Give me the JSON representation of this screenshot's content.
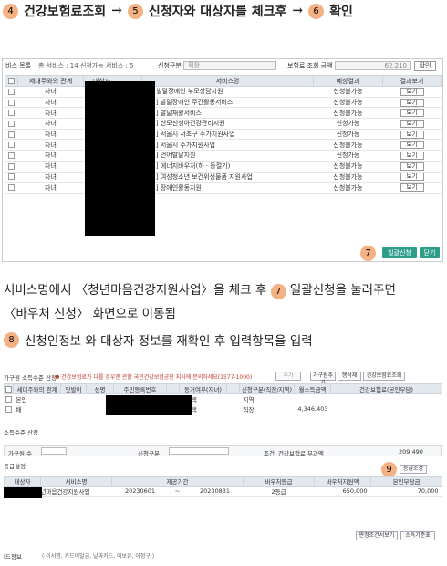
{
  "step_header": {
    "step4_num": "4",
    "step4_text": "건강보험료조회",
    "arrow": "→",
    "step5_num": "5",
    "step5_text": "신청자와 대상자를 체크후",
    "step6_num": "6",
    "step6_text": "확인"
  },
  "screen1": {
    "list_title": "비스 목록",
    "count_text": "총 서비스 : 14 신청가능 서비스 : 5",
    "category_label": "신청구분",
    "category_value": "직장",
    "insurance_label": "보험료 조회 금액",
    "insurance_value": "62,210",
    "confirm_label": "확인",
    "columns": [
      "",
      "세대주와의 관계",
      "대상자",
      "",
      "서비스명",
      "예상결과",
      "결과보기"
    ],
    "rows": [
      {
        "relation": "자녀",
        "service": "03] 발달장애인 부모상담지원",
        "result": "신청불가능",
        "view": "보기"
      },
      {
        "relation": "자녀",
        "service": "001] 발달장애인 주간활동서비스",
        "result": "신청불가능",
        "view": "보기"
      },
      {
        "relation": "자녀",
        "service": "001] 발달재활서비스",
        "result": "신청불가능",
        "view": "보기"
      },
      {
        "relation": "자녀",
        "service": "001] 산모신생아건강관리지원",
        "result": "신청가능",
        "view": "보기"
      },
      {
        "relation": "자녀",
        "service": "022] 서울시 서초구 주가지원사업",
        "result": "신청가능",
        "view": "보기"
      },
      {
        "relation": "자녀",
        "service": "001] 서울시 주가지원사업",
        "result": "신청불가능",
        "view": "보기"
      },
      {
        "relation": "자녀",
        "service": "002] 언어발달지원",
        "result": "신청가능",
        "view": "보기"
      },
      {
        "relation": "자녀",
        "service": "001] 에너지바우처(하 · 동절기)",
        "result": "신청불가능",
        "view": "보기"
      },
      {
        "relation": "자녀",
        "service": "001] 여성청소년 보건위생물품 지원사업",
        "result": "신청불가능",
        "view": "보기"
      },
      {
        "relation": "자녀",
        "service": "001] 장애인활동지원",
        "result": "신청불가능",
        "view": "보기"
      }
    ],
    "step7_num": "7",
    "bulk_apply": "일괄신청",
    "close": "닫기"
  },
  "instruction1": {
    "line1_a": "서비스명에서 〈청년마음건강지원사업〉을 체크 후",
    "line1_num": "7",
    "line1_b": "일괄신청을 눌러주면",
    "line2": "〈바우처 신청〉 화면으로 이동됨"
  },
  "instruction2": {
    "num": "8",
    "text": "신청인정보 와 대상자 정보를 재확인 후 입력항목을 입력"
  },
  "screen2": {
    "section_title": "가구원 소득수준 산정",
    "warning": "❶ 건강보험료가 다를 경우엔 관할 국민건강보험공단 지사에 문의하세요(1577-1000)",
    "btn_add": "추가",
    "btn_add_member": "가구원추가",
    "btn_delete": "행삭제",
    "btn_income_lookup": "건강보험료조회",
    "members_cols": [
      "",
      "세대주와의 관계",
      "핏발이",
      "성명",
      "주민등록번호",
      "",
      "동거여부(자녀)",
      "",
      "신청구분(직장/지역)",
      "월소득금액",
      "건강보험료(본인부담)"
    ],
    "members": [
      {
        "relation": "본인",
        "cohabit": "선택",
        "category": "지역",
        "income": ""
      },
      {
        "relation": "배",
        "cohabit": "선택",
        "category": "직장",
        "income": "4,346,403"
      }
    ],
    "income_title": "소득수준 산정",
    "members_count_label": "가구원 수",
    "category_label": "신청구분",
    "sum_label": "조건",
    "insurance_sum_label": "건강보험료 부과액",
    "insurance_sum_value": "209,490",
    "grade_title": "등급설정",
    "step9_num": "9",
    "grade_btn": "등급조정",
    "grade_cols": [
      "대상자",
      "서비스명",
      "제공기간",
      "",
      "",
      "바우처등급",
      "바우처지원액",
      "본인부담금"
    ],
    "grade_row": {
      "service": "년마음건강지원사업",
      "start": "20230601",
      "tilde": "~",
      "end": "20230831",
      "grade": "2등급",
      "support": "650,000",
      "copay": "70,000"
    },
    "btn_check_gong": "판정조건서보기",
    "btn_calc": "소득기준표",
    "doc_label": "I드정보",
    "doc_hint": "( 이서명, 카드이발급, 날짜카드, 이보유, 이정구 )"
  }
}
